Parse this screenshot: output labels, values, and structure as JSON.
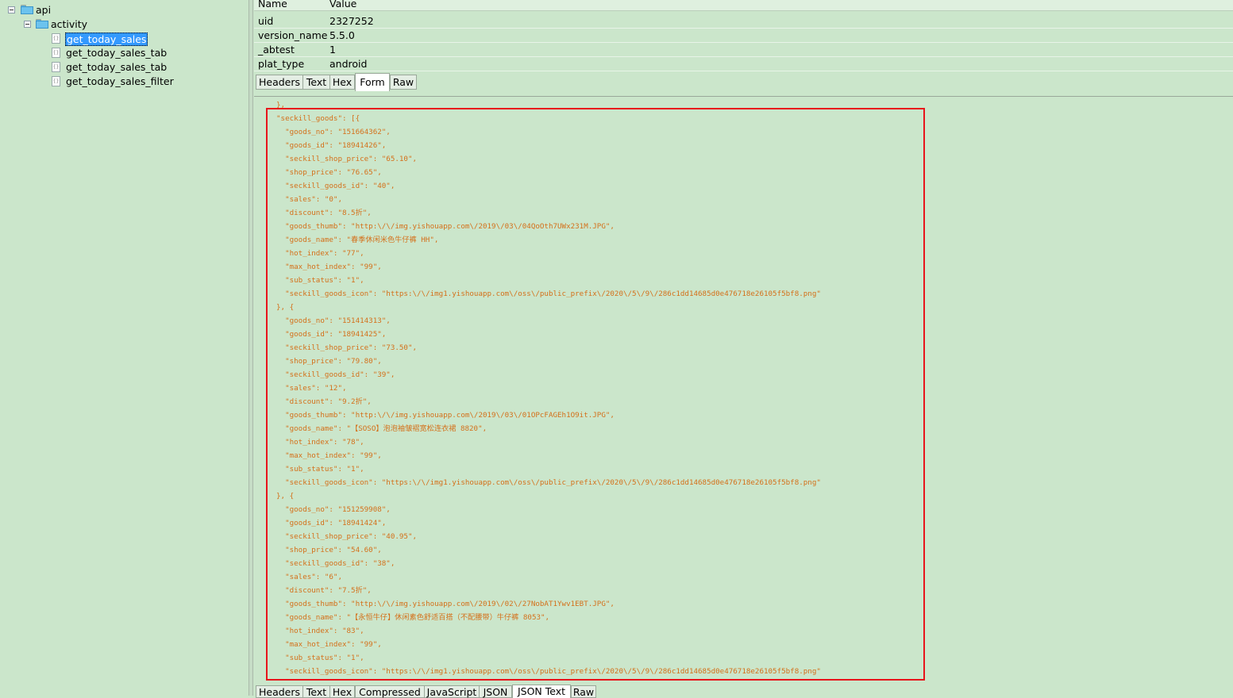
{
  "tree": {
    "items": [
      {
        "label": "api",
        "level": 1,
        "type": "folder"
      },
      {
        "label": "activity",
        "level": 2,
        "type": "folder"
      },
      {
        "label": "get_today_sales",
        "level": 3,
        "type": "file",
        "selected": true
      },
      {
        "label": "get_today_sales_tab",
        "level": 3,
        "type": "file"
      },
      {
        "label": "get_today_sales_tab",
        "level": 3,
        "type": "file"
      },
      {
        "label": "get_today_sales_filter",
        "level": 3,
        "type": "file"
      }
    ]
  },
  "form_grid": {
    "col_name": "Name",
    "col_value": "Value",
    "rows": [
      {
        "name": "uid",
        "value": "2327252"
      },
      {
        "name": "version_name",
        "value": "5.5.0"
      },
      {
        "name": "_abtest",
        "value": "1"
      },
      {
        "name": "plat_type",
        "value": "android"
      }
    ]
  },
  "request_tabs": {
    "items": [
      "Headers",
      "Text",
      "Hex",
      "Form",
      "Raw"
    ],
    "active": "Form"
  },
  "json_view": {
    "lines": [
      "},",
      "\"seckill_goods\": [{",
      "  \"goods_no\": \"151664362\",",
      "  \"goods_id\": \"18941426\",",
      "  \"seckill_shop_price\": \"65.10\",",
      "  \"shop_price\": \"76.65\",",
      "  \"seckill_goods_id\": \"40\",",
      "  \"sales\": \"0\",",
      "  \"discount\": \"8.5折\",",
      "  \"goods_thumb\": \"http:\\/\\/img.yishouapp.com\\/2019\\/03\\/04QoOth7UWx231M.JPG\",",
      "  \"goods_name\": \"春季休闲米色牛仔裤 HH\",",
      "  \"hot_index\": \"77\",",
      "  \"max_hot_index\": \"99\",",
      "  \"sub_status\": \"1\",",
      "  \"seckill_goods_icon\": \"https:\\/\\/img1.yishouapp.com\\/oss\\/public_prefix\\/2020\\/5\\/9\\/286c1dd14685d0e476718e26105f5bf8.png\"",
      "}, {",
      "  \"goods_no\": \"151414313\",",
      "  \"goods_id\": \"18941425\",",
      "  \"seckill_shop_price\": \"73.50\",",
      "  \"shop_price\": \"79.80\",",
      "  \"seckill_goods_id\": \"39\",",
      "  \"sales\": \"12\",",
      "  \"discount\": \"9.2折\",",
      "  \"goods_thumb\": \"http:\\/\\/img.yishouapp.com\\/2019\\/03\\/01OPcFAGEh1O9it.JPG\",",
      "  \"goods_name\": \"【SOSO】泡泡袖皱褶宽松连衣裙 8820\",",
      "  \"hot_index\": \"78\",",
      "  \"max_hot_index\": \"99\",",
      "  \"sub_status\": \"1\",",
      "  \"seckill_goods_icon\": \"https:\\/\\/img1.yishouapp.com\\/oss\\/public_prefix\\/2020\\/5\\/9\\/286c1dd14685d0e476718e26105f5bf8.png\"",
      "}, {",
      "  \"goods_no\": \"151259908\",",
      "  \"goods_id\": \"18941424\",",
      "  \"seckill_shop_price\": \"40.95\",",
      "  \"shop_price\": \"54.60\",",
      "  \"seckill_goods_id\": \"38\",",
      "  \"sales\": \"6\",",
      "  \"discount\": \"7.5折\",",
      "  \"goods_thumb\": \"http:\\/\\/img.yishouapp.com\\/2019\\/02\\/27NobAT1Ywv1EBT.JPG\",",
      "  \"goods_name\": \"【永恒牛仔】休闲素色舒适百搭（不配腰带）牛仔裤 8053\",",
      "  \"hot_index\": \"83\",",
      "  \"max_hot_index\": \"99\",",
      "  \"sub_status\": \"1\",",
      "  \"seckill_goods_icon\": \"https:\\/\\/img1.yishouapp.com\\/oss\\/public_prefix\\/2020\\/5\\/9\\/286c1dd14685d0e476718e26105f5bf8.png\""
    ]
  },
  "response_tabs": {
    "items": [
      "Headers",
      "Text",
      "Hex",
      "Compressed",
      "JavaScript",
      "JSON",
      "JSON Text",
      "Raw"
    ],
    "active": "JSON Text"
  },
  "colors": {
    "background": "#cbe6cb",
    "json_text": "#d4701a",
    "highlight_box": "#e8141b",
    "selection": "#3399ff"
  }
}
